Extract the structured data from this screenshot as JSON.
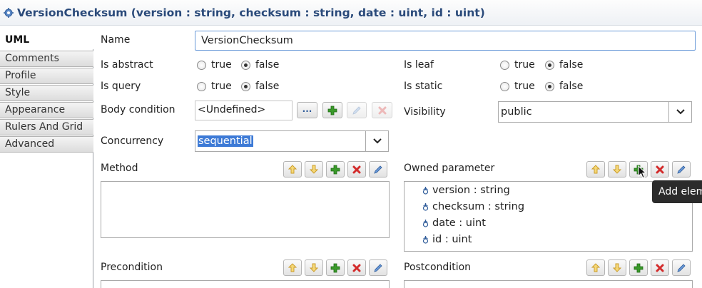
{
  "header": {
    "title": "VersionChecksum (version : string, checksum : string, date : uint, id : uint)"
  },
  "tabs": [
    "UML",
    "Comments",
    "Profile",
    "Style",
    "Appearance",
    "Rulers And Grid",
    "Advanced"
  ],
  "active_tab": "UML",
  "form": {
    "name_label": "Name",
    "name_value": "VersionChecksum",
    "is_abstract_label": "Is abstract",
    "is_query_label": "Is query",
    "is_leaf_label": "Is leaf",
    "is_static_label": "Is static",
    "true_label": "true",
    "false_label": "false",
    "body_condition_label": "Body condition",
    "body_condition_value": "<Undefined>",
    "body_more_label": "...",
    "visibility_label": "Visibility",
    "visibility_value": "public",
    "concurrency_label": "Concurrency",
    "concurrency_value": "sequential",
    "method_label": "Method",
    "owned_parameter_label": "Owned parameter",
    "precondition_label": "Precondition",
    "postcondition_label": "Postcondition"
  },
  "radio_state": {
    "is_abstract": "false",
    "is_query": "false",
    "is_leaf": "false",
    "is_static": "false"
  },
  "owned_parameters": [
    "version : string",
    "checksum : string",
    "date : uint",
    "id : uint"
  ],
  "tooltip": "Add elem",
  "colors": {
    "title": "#2a4a7a",
    "selection": "#3d7ad6",
    "focus_border": "#6a9ad8",
    "add_green": "#3a9a2a",
    "delete_red": "#d32b2b",
    "arrow_yellow": "#e0b030"
  }
}
